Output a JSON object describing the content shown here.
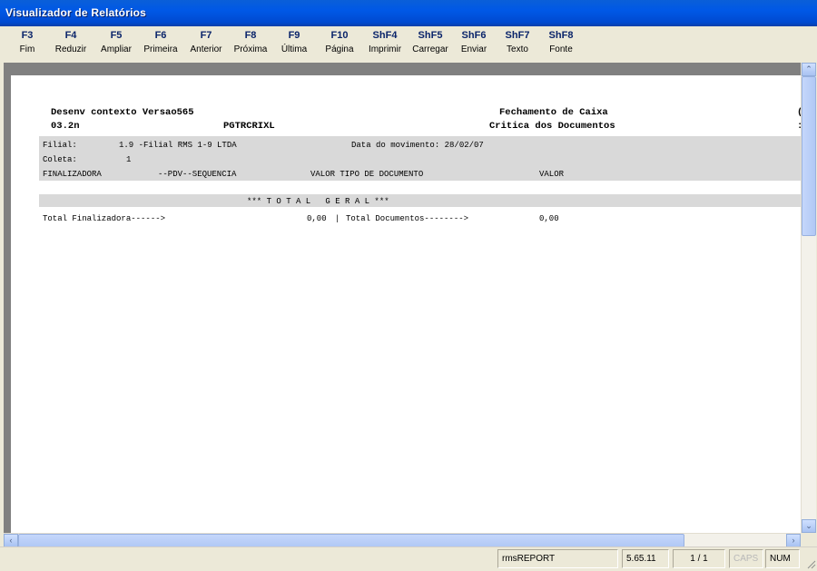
{
  "window": {
    "title": "Visualizador de Relatórios"
  },
  "toolbar": [
    {
      "key": "F3",
      "label": "Fim"
    },
    {
      "key": "F4",
      "label": "Reduzir"
    },
    {
      "key": "F5",
      "label": "Ampliar"
    },
    {
      "key": "F6",
      "label": "Primeira"
    },
    {
      "key": "F7",
      "label": "Anterior"
    },
    {
      "key": "F8",
      "label": "Próxima"
    },
    {
      "key": "F9",
      "label": "Última"
    },
    {
      "key": "F10",
      "label": "Página"
    },
    {
      "key": "ShF4",
      "label": "Imprimir"
    },
    {
      "key": "ShF5",
      "label": "Carregar"
    },
    {
      "key": "ShF6",
      "label": "Enviar"
    },
    {
      "key": "ShF7",
      "label": "Texto"
    },
    {
      "key": "ShF8",
      "label": "Fonte"
    }
  ],
  "report": {
    "line1_left": "Desenv contexto Versao565",
    "line1_right": "Fechamento de Caixa",
    "line1_cut": "(",
    "line2_code": "03.2n",
    "line2_prog": "PGTRCRIXL",
    "line2_right": "Critica dos Documentos",
    "line2_cut": ":",
    "filial_label": "Filial:",
    "filial_value": "1.9 -Filial RMS 1-9 LTDA",
    "data_label": "Data do movimento: 28/02/07",
    "coleta_label": "Coleta:",
    "coleta_value": "1",
    "col_finalizadora": "FINALIZADORA",
    "col_pdv": "--PDV--SEQUENCIA",
    "col_valor_tipo": "VALOR TIPO DE DOCUMENTO",
    "col_valor": "VALOR",
    "total_geral": "*** T O T A L   G E R A L ***",
    "total_final_label": "Total Finalizadora------>",
    "total_final_value": "0,00",
    "total_sep": "|",
    "total_docs_label": "Total Documentos-------->",
    "total_docs_value": "0,00"
  },
  "scrollbars": {
    "up": "⌃",
    "down": "⌄",
    "left": "‹",
    "right": "›"
  },
  "status": {
    "app": "rmsREPORT",
    "version": "5.65.11",
    "page": "1 / 1",
    "caps": "CAPS",
    "num": "NUM"
  }
}
